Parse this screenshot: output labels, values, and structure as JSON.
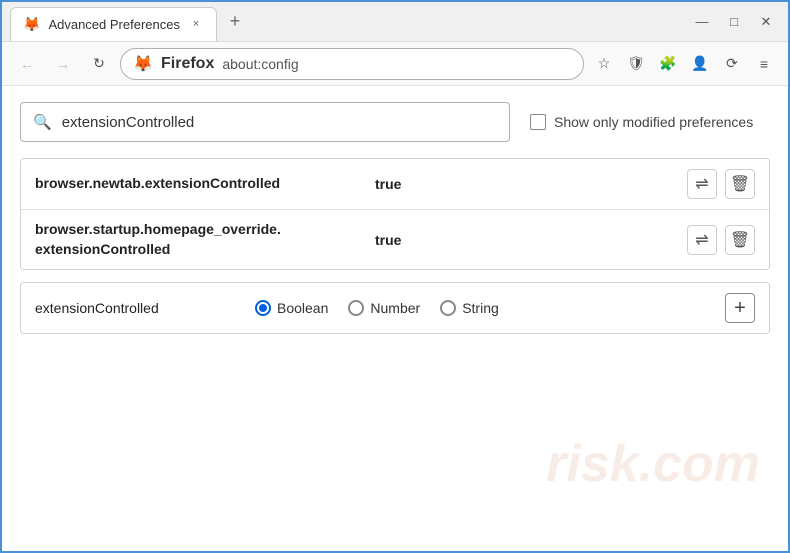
{
  "title_bar": {
    "tab_title": "Advanced Preferences",
    "tab_close_icon": "×",
    "new_tab_icon": "+",
    "minimize_icon": "—",
    "maximize_icon": "□",
    "close_icon": "✕"
  },
  "nav_bar": {
    "back_icon": "←",
    "forward_icon": "→",
    "reload_icon": "↻",
    "brand": "Firefox",
    "url": "about:config",
    "bookmark_icon": "☆",
    "shield_icon": "🛡",
    "ext_icon": "🧩",
    "profile_icon": "👤",
    "sync_icon": "⟳",
    "menu_icon": "≡"
  },
  "search": {
    "placeholder": "extensionControlled",
    "value": "extensionControlled",
    "search_icon": "🔍",
    "show_modified_label": "Show only modified preferences"
  },
  "prefs": [
    {
      "name": "browser.newtab.extensionControlled",
      "value": "true"
    },
    {
      "name": "browser.startup.homepage_override.\nextensionControlled",
      "name_line1": "browser.startup.homepage_override.",
      "name_line2": "extensionControlled",
      "value": "true"
    }
  ],
  "add_pref": {
    "name": "extensionControlled",
    "types": [
      {
        "label": "Boolean",
        "selected": true
      },
      {
        "label": "Number",
        "selected": false
      },
      {
        "label": "String",
        "selected": false
      }
    ],
    "add_icon": "+"
  },
  "watermark": {
    "line1": "risk.com"
  }
}
